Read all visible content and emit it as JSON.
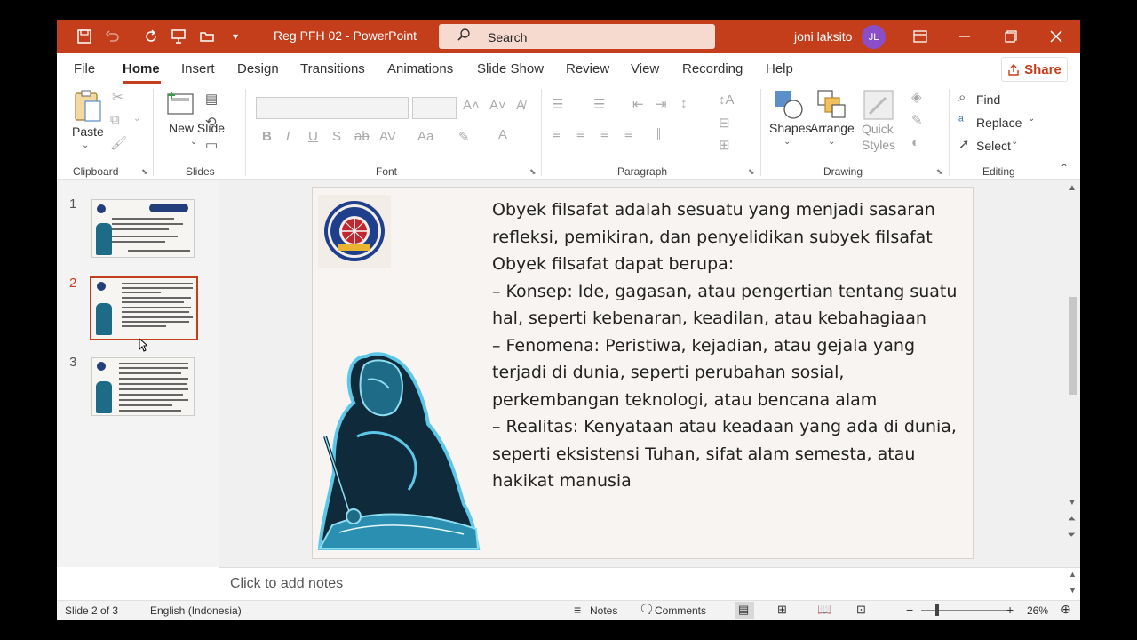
{
  "titlebar": {
    "doc_title": "Reg PFH 02  -  PowerPoint",
    "search_label": "Search",
    "user_name": "joni laksito",
    "user_initials": "JL"
  },
  "menu": {
    "tabs": [
      "File",
      "Home",
      "Insert",
      "Design",
      "Transitions",
      "Animations",
      "Slide Show",
      "Review",
      "View",
      "Recording",
      "Help"
    ],
    "active_tab": "Home",
    "share_label": "Share"
  },
  "ribbon": {
    "clipboard": {
      "label": "Clipboard",
      "paste_label": "Paste"
    },
    "slides": {
      "label": "Slides",
      "new_slide_label": "New Slide"
    },
    "font": {
      "label": "Font"
    },
    "paragraph": {
      "label": "Paragraph"
    },
    "drawing": {
      "label": "Drawing",
      "shapes_label": "Shapes",
      "arrange_label": "Arrange",
      "quick_styles_label": "Quick Styles"
    },
    "editing": {
      "label": "Editing",
      "find_label": "Find",
      "replace_label": "Replace",
      "select_label": "Select"
    }
  },
  "thumbnails": [
    {
      "number": "1",
      "selected": false
    },
    {
      "number": "2",
      "selected": true
    },
    {
      "number": "3",
      "selected": false
    }
  ],
  "slide": {
    "lines": [
      "Obyek filsafat adalah sesuatu yang menjadi sasaran refleksi, pemikiran, dan penyelidikan subyek filsafat",
      "Obyek filsafat dapat berupa:",
      "– Konsep: Ide, gagasan, atau pengertian tentang suatu hal, seperti kebenaran, keadilan, atau kebahagiaan",
      "– Fenomena: Peristiwa, kejadian, atau gejala yang terjadi di dunia, seperti perubahan sosial, perkembangan teknologi, atau bencana alam",
      "– Realitas: Kenyataan atau keadaan yang ada di dunia, seperti eksistensi Tuhan, sifat alam semesta, atau hakikat manusia"
    ]
  },
  "notes": {
    "placeholder": "Click to add notes"
  },
  "statusbar": {
    "slide_info": "Slide 2 of 3",
    "language": "English (Indonesia)",
    "notes_label": "Notes",
    "comments_label": "Comments",
    "zoom": "26%"
  },
  "colors": {
    "accent": "#c43e1c",
    "avatar": "#8a4fc8"
  }
}
